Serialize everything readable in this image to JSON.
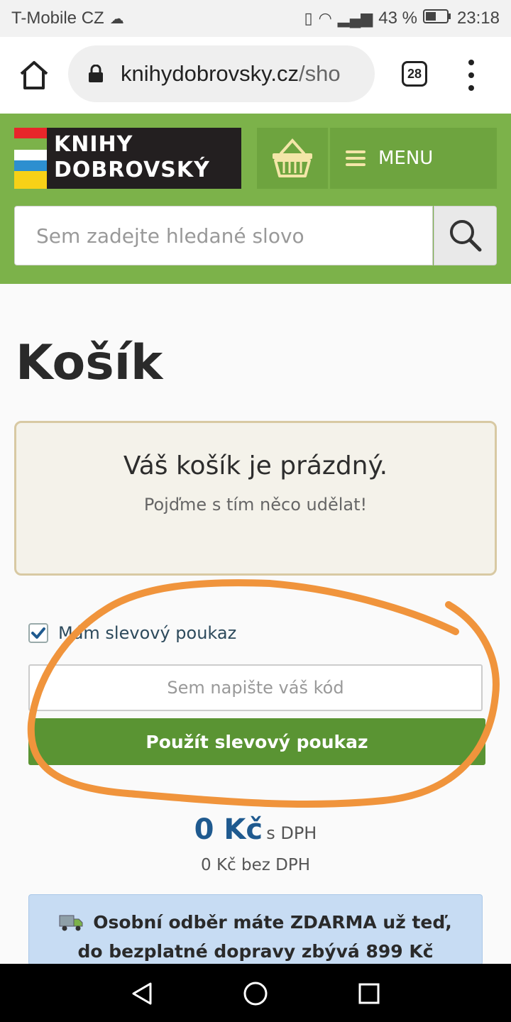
{
  "status": {
    "carrier": "T-Mobile CZ",
    "battery": "43 %",
    "time": "23:18"
  },
  "browser": {
    "url_domain": "knihydobrovsky.cz",
    "url_rest": "/sho",
    "tab_count": "28"
  },
  "header": {
    "logo_line1": "KNIHY",
    "logo_line2": "DOBROVSKÝ",
    "logo_colors": [
      "#e8262a",
      "#7cb24a",
      "#ffffff",
      "#2d8fd0",
      "#f7d117"
    ],
    "menu_label": "MENU",
    "search_placeholder": "Sem zadejte hledané slovo"
  },
  "main": {
    "title": "Košík",
    "empty_title": "Váš košík je prázdný.",
    "empty_subtitle": "Pojďme s tím něco udělat!",
    "voucher_checkbox_label": "Mám slevový poukaz",
    "voucher_checked": true,
    "voucher_placeholder": "Sem napište váš kód",
    "apply_button": "Použít slevový poukaz",
    "price_value": "0 Kč",
    "price_suffix": "s DPH",
    "price_net": "0 Kč bez DPH",
    "shipping_line1": "Osobní odběr máte ZDARMA už teď,",
    "shipping_line2": "do bezplatné dopravy zbývá 899 Kč"
  },
  "colors": {
    "brand_green": "#7cb24a",
    "button_green": "#5a9433",
    "price_blue": "#1f5a8f",
    "annotation_orange": "#f0943c"
  }
}
